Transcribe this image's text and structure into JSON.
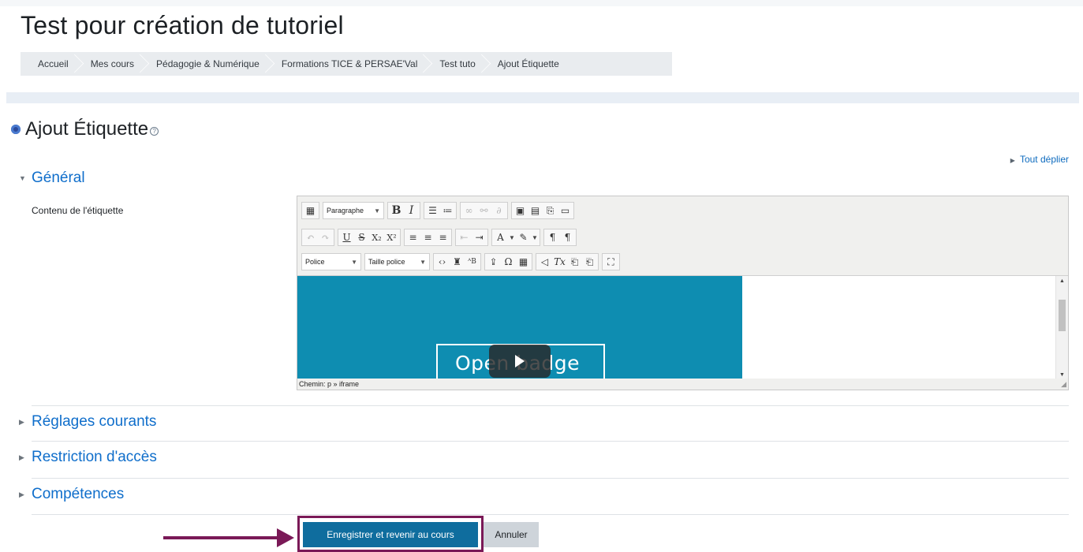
{
  "page": {
    "title": "Test pour création de tutoriel"
  },
  "breadcrumb": [
    "Accueil",
    "Mes cours",
    "Pédagogie & Numérique",
    "Formations TICE & PERSAE'Val",
    "Test tuto",
    "Ajout Étiquette"
  ],
  "heading": {
    "text": "Ajout Étiquette",
    "help_icon": "?"
  },
  "expand_all": {
    "label": "Tout déplier"
  },
  "sections": {
    "general": "Général",
    "reglages": "Réglages courants",
    "restriction": "Restriction d'accès",
    "competences": "Compétences"
  },
  "field": {
    "label": "Contenu de l'étiquette"
  },
  "editor": {
    "format_select": "Paragraphe",
    "font_select": "Police",
    "size_select": "Taille police",
    "embed_text": "Open badge",
    "path": "Chemin: p » iframe",
    "embed_color": "#0e8db1"
  },
  "buttons": {
    "save": "Enregistrer et revenir au cours",
    "cancel": "Annuler"
  },
  "colors": {
    "accent": "#0f6ecb",
    "primary_button": "#0f6d9e",
    "highlight": "#7a1957"
  }
}
